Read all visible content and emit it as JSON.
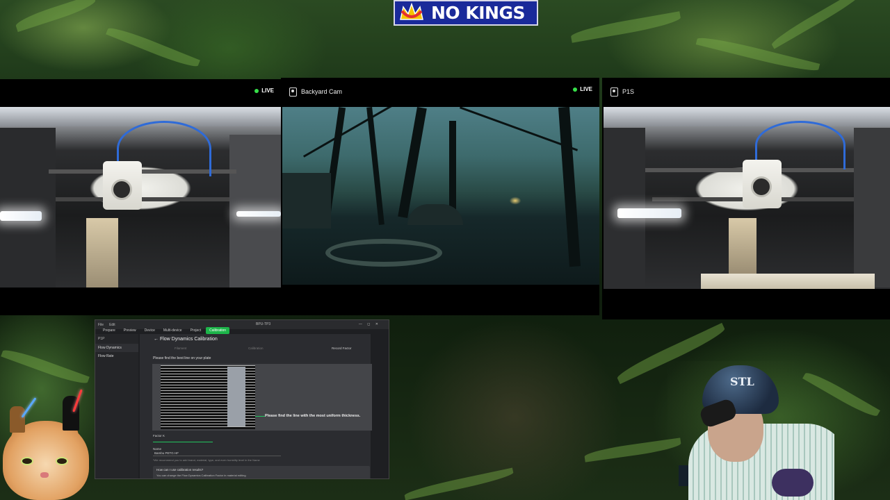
{
  "logo": {
    "text": "NO KINGS",
    "icon": "crown-icon"
  },
  "cameras": [
    {
      "title": "",
      "live_label": "LIVE",
      "icon": "camera-icon"
    },
    {
      "title": "Backyard Cam",
      "live_label": "LIVE",
      "icon": "camera-icon"
    },
    {
      "title": "P1S",
      "live_label": "",
      "icon": "camera-icon"
    }
  ],
  "app": {
    "window_title": "BPU-TP3",
    "menu": [
      "File",
      "Edit"
    ],
    "window_controls": "— ◻ ✕",
    "tabs": [
      {
        "label": "Prepare",
        "active": false
      },
      {
        "label": "Preview",
        "active": false
      },
      {
        "label": "Device",
        "active": false
      },
      {
        "label": "Multi-device",
        "active": false
      },
      {
        "label": "Project",
        "active": false
      },
      {
        "label": "Calibration",
        "active": true
      }
    ],
    "sidebar": {
      "printer": "P1P",
      "items": [
        {
          "label": "Flow Dynamics",
          "active": true
        },
        {
          "label": "Flow Rate",
          "active": false
        }
      ]
    },
    "main": {
      "title": "Flow Dynamics Calibration",
      "steps": [
        "Filament",
        "Calibration",
        "Record Factor"
      ],
      "instruction": "Please find the best line on your plate",
      "plate_message": "Please find the line with the most uniform thickness.",
      "factor_label": "Factor K",
      "factor_value": "",
      "name_label": "Name",
      "name_value": "Bambu PETG HF",
      "name_hint": "*We recommend you to add brand, material, type, and even humidity level in the Name",
      "faq_question": "How can I use calibration results?",
      "faq_answer": "You can change the Flow Dynamics Calibration Factor in material editing"
    }
  },
  "webcam": {
    "helmet_text": "STL"
  },
  "colors": {
    "accent": "#1db54a",
    "live_dot": "#37e04a",
    "logo_bg": "#1a2a9a"
  }
}
